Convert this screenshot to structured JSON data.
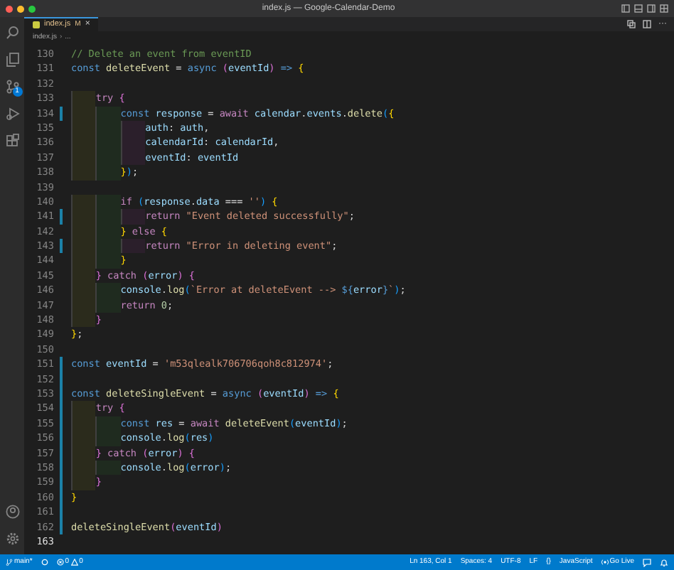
{
  "window": {
    "title": "index.js — Google-Calendar-Demo"
  },
  "tab": {
    "label": "index.js",
    "status": "M",
    "close": "×",
    "selected": true
  },
  "breadcrumb": {
    "items": [
      "index.js",
      "..."
    ],
    "separator": "›"
  },
  "editor_actions": {
    "more": "···"
  },
  "activity_bar": {
    "badge": "1"
  },
  "lines": [
    {
      "number": "130",
      "changed": false,
      "current": false,
      "tokens": [
        {
          "text": "// Delete an event from eventID",
          "kind": "comment"
        }
      ]
    },
    {
      "number": "131",
      "changed": false,
      "current": false,
      "tokens": [
        {
          "text": "const",
          "kind": "kw"
        },
        {
          "text": " deleteEvent",
          "kind": "fn"
        },
        {
          "text": " =",
          "kind": "punc"
        },
        {
          "text": " async",
          "kind": "kw"
        },
        {
          "text": " (",
          "kind": "brace2"
        },
        {
          "text": "eventId",
          "kind": "var"
        },
        {
          "text": ")",
          "kind": "brace2"
        },
        {
          "text": " =>",
          "kind": "kw"
        },
        {
          "text": " {",
          "kind": "brace1"
        }
      ]
    },
    {
      "number": "132",
      "changed": false,
      "current": false
    },
    {
      "number": "133",
      "changed": false,
      "current": false,
      "tokens": [
        {
          "text": "    try",
          "kind": "ctrl"
        },
        {
          "text": " {",
          "kind": "brace2"
        }
      ]
    },
    {
      "number": "134",
      "changed": true,
      "current": false,
      "tokens": [
        {
          "text": "        const",
          "kind": "kw"
        },
        {
          "text": " response",
          "kind": "var"
        },
        {
          "text": " =",
          "kind": "punc"
        },
        {
          "text": " await",
          "kind": "ctrl"
        },
        {
          "text": " calendar",
          "kind": "var"
        },
        {
          "text": ".",
          "kind": "punc"
        },
        {
          "text": "events",
          "kind": "var"
        },
        {
          "text": ".",
          "kind": "punc"
        },
        {
          "text": "delete",
          "kind": "fn"
        },
        {
          "text": "(",
          "kind": "brace3"
        },
        {
          "text": "{",
          "kind": "brace1"
        }
      ]
    },
    {
      "number": "135",
      "changed": false,
      "current": false,
      "tokens": [
        {
          "text": "            auth",
          "kind": "var"
        },
        {
          "text": ":",
          "kind": "punc"
        },
        {
          "text": " auth",
          "kind": "var"
        },
        {
          "text": ",",
          "kind": "punc"
        }
      ]
    },
    {
      "number": "136",
      "changed": false,
      "current": false,
      "tokens": [
        {
          "text": "            calendarId",
          "kind": "var"
        },
        {
          "text": ":",
          "kind": "punc"
        },
        {
          "text": " calendarId",
          "kind": "var"
        },
        {
          "text": ",",
          "kind": "punc"
        }
      ]
    },
    {
      "number": "137",
      "changed": false,
      "current": false,
      "tokens": [
        {
          "text": "            eventId",
          "kind": "var"
        },
        {
          "text": ":",
          "kind": "punc"
        },
        {
          "text": " eventId",
          "kind": "var"
        }
      ]
    },
    {
      "number": "138",
      "changed": false,
      "current": false,
      "tokens": [
        {
          "text": "        }",
          "kind": "brace1"
        },
        {
          "text": ")",
          "kind": "brace3"
        },
        {
          "text": ";",
          "kind": "punc"
        }
      ]
    },
    {
      "number": "139",
      "changed": false,
      "current": false
    },
    {
      "number": "140",
      "changed": false,
      "current": false,
      "tokens": [
        {
          "text": "        if",
          "kind": "ctrl"
        },
        {
          "text": " (",
          "kind": "brace3"
        },
        {
          "text": "response",
          "kind": "var"
        },
        {
          "text": ".",
          "kind": "punc"
        },
        {
          "text": "data",
          "kind": "var"
        },
        {
          "text": " ===",
          "kind": "punc"
        },
        {
          "text": " ''",
          "kind": "str"
        },
        {
          "text": ")",
          "kind": "brace3"
        },
        {
          "text": " {",
          "kind": "brace1"
        }
      ]
    },
    {
      "number": "141",
      "changed": true,
      "current": false,
      "tokens": [
        {
          "text": "            return",
          "kind": "ctrl"
        },
        {
          "text": " \"Event deleted successfully\"",
          "kind": "str"
        },
        {
          "text": ";",
          "kind": "punc"
        }
      ]
    },
    {
      "number": "142",
      "changed": false,
      "current": false,
      "tokens": [
        {
          "text": "        }",
          "kind": "brace1"
        },
        {
          "text": " else",
          "kind": "ctrl"
        },
        {
          "text": " {",
          "kind": "brace1"
        }
      ]
    },
    {
      "number": "143",
      "changed": true,
      "current": false,
      "tokens": [
        {
          "text": "            return",
          "kind": "ctrl"
        },
        {
          "text": " \"Error in deleting event\"",
          "kind": "str"
        },
        {
          "text": ";",
          "kind": "punc"
        }
      ]
    },
    {
      "number": "144",
      "changed": false,
      "current": false,
      "tokens": [
        {
          "text": "        }",
          "kind": "brace1"
        }
      ]
    },
    {
      "number": "145",
      "changed": false,
      "current": false,
      "tokens": [
        {
          "text": "    }",
          "kind": "brace2"
        },
        {
          "text": " catch",
          "kind": "ctrl"
        },
        {
          "text": " (",
          "kind": "brace2"
        },
        {
          "text": "error",
          "kind": "var"
        },
        {
          "text": ")",
          "kind": "brace2"
        },
        {
          "text": " {",
          "kind": "brace2"
        }
      ]
    },
    {
      "number": "146",
      "changed": false,
      "current": false,
      "tokens": [
        {
          "text": "        console",
          "kind": "var"
        },
        {
          "text": ".",
          "kind": "punc"
        },
        {
          "text": "log",
          "kind": "fn"
        },
        {
          "text": "(",
          "kind": "brace3"
        },
        {
          "text": "`Error at deleteEvent --> ",
          "kind": "str"
        },
        {
          "text": "${",
          "kind": "kw"
        },
        {
          "text": "error",
          "kind": "var"
        },
        {
          "text": "}",
          "kind": "kw"
        },
        {
          "text": "`",
          "kind": "str"
        },
        {
          "text": ")",
          "kind": "brace3"
        },
        {
          "text": ";",
          "kind": "punc"
        }
      ]
    },
    {
      "number": "147",
      "changed": false,
      "current": false,
      "tokens": [
        {
          "text": "        return",
          "kind": "ctrl"
        },
        {
          "text": " 0",
          "kind": "num"
        },
        {
          "text": ";",
          "kind": "punc"
        }
      ]
    },
    {
      "number": "148",
      "changed": false,
      "current": false,
      "tokens": [
        {
          "text": "    }",
          "kind": "brace2"
        }
      ]
    },
    {
      "number": "149",
      "changed": false,
      "current": false,
      "tokens": [
        {
          "text": "}",
          "kind": "brace1"
        },
        {
          "text": ";",
          "kind": "punc"
        }
      ]
    },
    {
      "number": "150",
      "changed": false,
      "current": false
    },
    {
      "number": "151",
      "changed": true,
      "current": false,
      "tokens": [
        {
          "text": "const",
          "kind": "kw"
        },
        {
          "text": " eventId",
          "kind": "var"
        },
        {
          "text": " =",
          "kind": "punc"
        },
        {
          "text": " 'm53qlealk706706qoh8c812974'",
          "kind": "str"
        },
        {
          "text": ";",
          "kind": "punc"
        }
      ]
    },
    {
      "number": "152",
      "changed": true,
      "current": false
    },
    {
      "number": "153",
      "changed": true,
      "current": false,
      "tokens": [
        {
          "text": "const",
          "kind": "kw"
        },
        {
          "text": " deleteSingleEvent",
          "kind": "fn"
        },
        {
          "text": " =",
          "kind": "punc"
        },
        {
          "text": " async",
          "kind": "kw"
        },
        {
          "text": " (",
          "kind": "brace2"
        },
        {
          "text": "eventId",
          "kind": "var"
        },
        {
          "text": ")",
          "kind": "brace2"
        },
        {
          "text": " =>",
          "kind": "kw"
        },
        {
          "text": " {",
          "kind": "brace1"
        }
      ]
    },
    {
      "number": "154",
      "changed": true,
      "current": false,
      "tokens": [
        {
          "text": "    try",
          "kind": "ctrl"
        },
        {
          "text": " {",
          "kind": "brace2"
        }
      ]
    },
    {
      "number": "155",
      "changed": true,
      "current": false,
      "tokens": [
        {
          "text": "        const",
          "kind": "kw"
        },
        {
          "text": " res",
          "kind": "var"
        },
        {
          "text": " =",
          "kind": "punc"
        },
        {
          "text": " await",
          "kind": "ctrl"
        },
        {
          "text": " deleteEvent",
          "kind": "fn"
        },
        {
          "text": "(",
          "kind": "brace3"
        },
        {
          "text": "eventId",
          "kind": "var"
        },
        {
          "text": ")",
          "kind": "brace3"
        },
        {
          "text": ";",
          "kind": "punc"
        }
      ]
    },
    {
      "number": "156",
      "changed": true,
      "current": false,
      "tokens": [
        {
          "text": "        console",
          "kind": "var"
        },
        {
          "text": ".",
          "kind": "punc"
        },
        {
          "text": "log",
          "kind": "fn"
        },
        {
          "text": "(",
          "kind": "brace3"
        },
        {
          "text": "res",
          "kind": "var"
        },
        {
          "text": ")",
          "kind": "brace3"
        }
      ]
    },
    {
      "number": "157",
      "changed": true,
      "current": false,
      "tokens": [
        {
          "text": "    }",
          "kind": "brace2"
        },
        {
          "text": " catch",
          "kind": "ctrl"
        },
        {
          "text": " (",
          "kind": "brace2"
        },
        {
          "text": "error",
          "kind": "var"
        },
        {
          "text": ")",
          "kind": "brace2"
        },
        {
          "text": " {",
          "kind": "brace2"
        }
      ]
    },
    {
      "number": "158",
      "changed": true,
      "current": false,
      "tokens": [
        {
          "text": "        console",
          "kind": "var"
        },
        {
          "text": ".",
          "kind": "punc"
        },
        {
          "text": "log",
          "kind": "fn"
        },
        {
          "text": "(",
          "kind": "brace3"
        },
        {
          "text": "error",
          "kind": "var"
        },
        {
          "text": ")",
          "kind": "brace3"
        },
        {
          "text": ";",
          "kind": "punc"
        }
      ]
    },
    {
      "number": "159",
      "changed": true,
      "current": false,
      "tokens": [
        {
          "text": "    }",
          "kind": "brace2"
        }
      ]
    },
    {
      "number": "160",
      "changed": true,
      "current": false,
      "tokens": [
        {
          "text": "}",
          "kind": "brace1"
        }
      ]
    },
    {
      "number": "161",
      "changed": true,
      "current": false
    },
    {
      "number": "162",
      "changed": true,
      "current": false,
      "tokens": [
        {
          "text": "deleteSingleEvent",
          "kind": "fn"
        },
        {
          "text": "(",
          "kind": "brace2"
        },
        {
          "text": "eventId",
          "kind": "var"
        },
        {
          "text": ")",
          "kind": "brace2"
        }
      ]
    },
    {
      "number": "163",
      "changed": false,
      "current": true
    }
  ],
  "status_bar": {
    "branch": "main*",
    "errors": "0",
    "warnings": "0",
    "position": "Ln 163, Col 1",
    "indentation": "Spaces: 4",
    "encoding": "UTF-8",
    "line_ending": "LF",
    "language_icon": "{}",
    "language": "JavaScript",
    "live": "Go Live"
  }
}
